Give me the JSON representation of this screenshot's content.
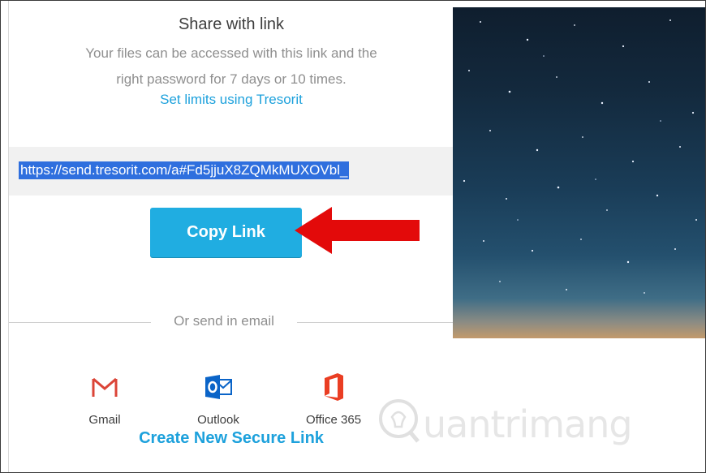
{
  "share": {
    "title": "Share with link",
    "description_line1": "Your files can be accessed with this link and the",
    "description_line2": "right password for 7 days or 10 times.",
    "limits_link": "Set limits using Tresorit",
    "url": "https://send.tresorit.com/a#Fd5jjuX8ZQMkMUXOVbl_",
    "copy_button": "Copy Link",
    "or_text": "Or send in email",
    "create_link": "Create New Secure Link"
  },
  "email_options": [
    {
      "label": "Gmail",
      "icon": "gmail-icon",
      "color": "#db4437"
    },
    {
      "label": "Outlook",
      "icon": "outlook-icon",
      "color": "#0a64c8"
    },
    {
      "label": "Office 365",
      "icon": "office365-icon",
      "color": "#ea3e23"
    }
  ],
  "annotation": {
    "arrow_color": "#e30a0a"
  },
  "colors": {
    "accent": "#1da1dc",
    "button": "#20ade1",
    "selection": "#2f6fde"
  },
  "watermark": {
    "text": "uantrimang"
  }
}
